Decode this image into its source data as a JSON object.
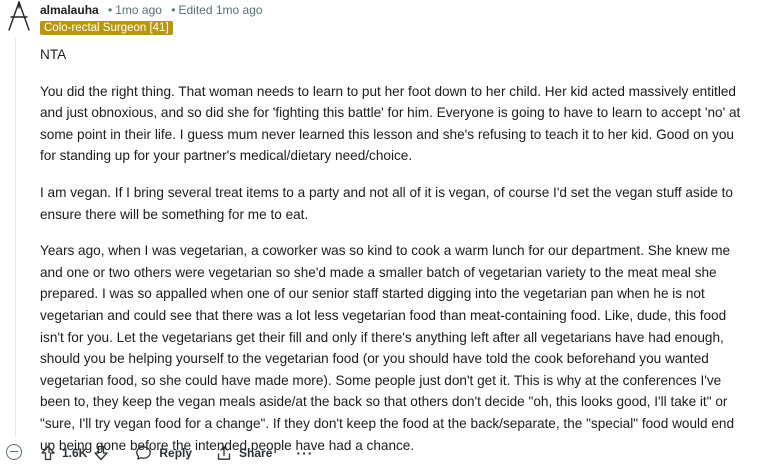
{
  "comment": {
    "username": "almalauha",
    "time": "1mo ago",
    "edited": "Edited 1mo ago",
    "flair": "Colo-rectal Surgeon [41]",
    "paragraphs": [
      "NTA",
      "You did the right thing. That woman needs to learn to put her foot down to her child. Her kid acted massively entitled and just obnoxious, and so did she for 'fighting this battle' for him. Everyone is going to have to learn to accept 'no' at some point in their life. I guess mum never learned this lesson and she's refusing to teach it to her kid. Good on you for standing up for your partner's medical/dietary need/choice.",
      "I am vegan. If I bring several treat items to a party and not all of it is vegan, of course I'd set the vegan stuff aside to ensure there will be something for me to eat.",
      "Years ago, when I was vegetarian, a coworker was so kind to cook a warm lunch for our department. She knew me and one or two others were vegetarian so she'd made a smaller batch of vegetarian variety to the meat meal she prepared. I was so appalled when one of our senior staff started digging into the vegetarian pan when he is not vegetarian and could see that there was a lot less vegetarian food than meat-containing food. Like, dude, this food isn't for you. Let the vegetarians get their fill and only if there's anything left after all vegetarians have had enough, should you be helping yourself to the vegetarian food (or you should have told the cook beforehand you wanted vegetarian food, so she could have made more). Some people just don't get it. This is why at the conferences I've been to, they keep the vegan meals aside/at the back so that others don't decide \"oh, this looks good, I'll take it\" or \"sure, I'll try vegan food for a change\". If they don't keep the food at the back/separate, the \"special\" food would end up being gone before the intended people have had a chance."
    ]
  },
  "actions": {
    "upvote_icon": "upvote-arrow-icon",
    "vote_count": "1.6K",
    "downvote_icon": "downvote-arrow-icon",
    "reply_label": "Reply",
    "share_label": "Share",
    "more_label": "···"
  },
  "colors": {
    "flair_bg": "#b8960f",
    "muted": "#576f76",
    "text": "#1c1c1c"
  }
}
